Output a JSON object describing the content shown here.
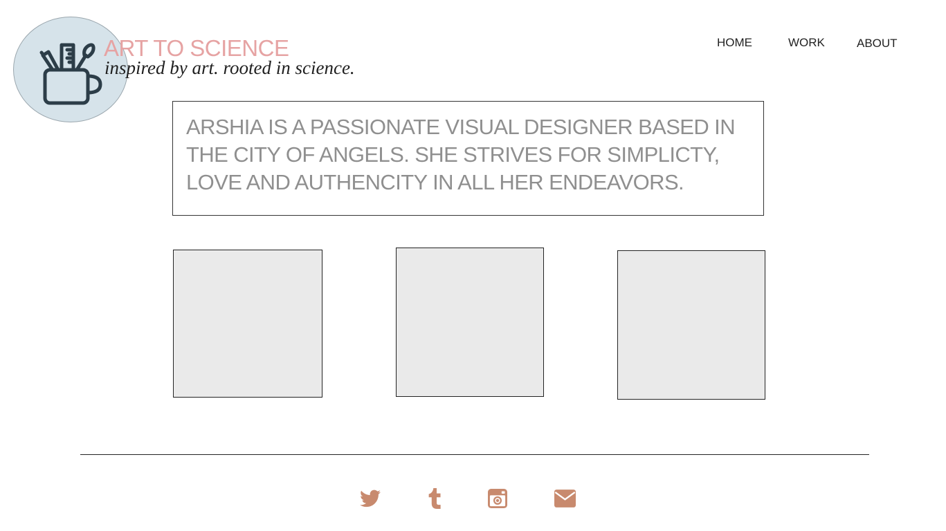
{
  "brand": {
    "title": "ART TO SCIENCE",
    "tagline": "inspired by art. rooted in science.",
    "logo_icon": "mug-with-pencil-ruler-brush-icon",
    "title_color": "#e6a3a3",
    "circle_color": "#d6e3ea"
  },
  "nav": {
    "home": "HOME",
    "work": "WORK",
    "about": "ABOUT"
  },
  "bio": {
    "lines": [
      "ARSHIA IS A PASSIONATE VISUAL DESIGNER BASED IN",
      "THE CITY OF ANGELS. SHE STRIVES FOR SIMPLICTY,",
      "LOVE AND AUTHENCITY IN ALL HER ENDEAVORS."
    ],
    "text_color": "#8f8f8f"
  },
  "social": {
    "color": "#c88a6e",
    "icons": [
      "twitter-icon",
      "tumblr-icon",
      "instagram-icon",
      "email-icon"
    ]
  }
}
